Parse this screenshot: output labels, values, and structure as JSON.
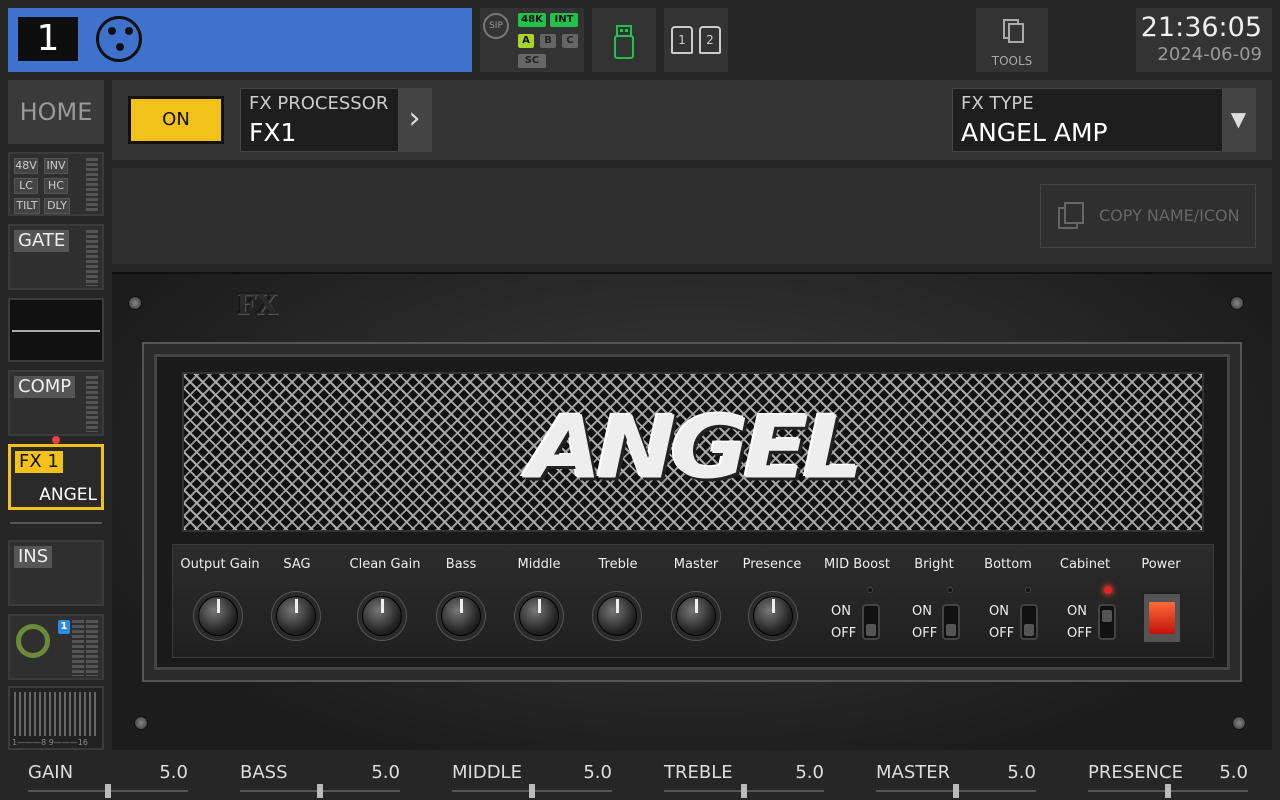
{
  "channel": {
    "number": "1",
    "connector_icon": "xlr-icon"
  },
  "status": {
    "sip": "SIP",
    "rate": "48K",
    "clock": "INT",
    "buses": [
      "A",
      "B",
      "C"
    ],
    "sc": "SC",
    "colors": {
      "active": "#1fc24a",
      "inactive": "#666666"
    }
  },
  "usb": {
    "icon": "usb-icon"
  },
  "cards": {
    "slot1": "1",
    "slot2": "2"
  },
  "tools": {
    "label": "TOOLS",
    "icon": "copy-docs-icon"
  },
  "clock": {
    "time": "21:36:05",
    "date": "2024-06-09"
  },
  "sidebar": {
    "home": "HOME",
    "preamp_tags": [
      "48V",
      "INV",
      "LC",
      "HC",
      "TILT",
      "DLY"
    ],
    "gate": "GATE",
    "comp": "COMP",
    "fx1": {
      "label": "FX 1",
      "name": "ANGEL"
    },
    "ins": "INS",
    "meter_badge": "1",
    "meter_scale": "1———8 9———16"
  },
  "header": {
    "on_label": "ON",
    "fx_processor_label": "FX PROCESSOR",
    "fx_processor_value": "FX1",
    "fx_type_label": "FX TYPE",
    "fx_type_value": "ANGEL AMP"
  },
  "copy_button": "COPY NAME/ICON",
  "amp": {
    "fx_logo": "FX",
    "brand": "ANGEL",
    "knobs": [
      "Output Gain",
      "SAG",
      "Clean Gain",
      "Bass",
      "Middle",
      "Treble",
      "Master",
      "Presence"
    ],
    "switches": [
      {
        "label": "MID Boost",
        "on": "ON",
        "off": "OFF"
      },
      {
        "label": "Bright",
        "on": "ON",
        "off": "OFF"
      },
      {
        "label": "Bottom",
        "on": "ON",
        "off": "OFF"
      },
      {
        "label": "Cabinet",
        "on": "ON",
        "off": "OFF"
      }
    ],
    "power": "Power"
  },
  "params": [
    {
      "name": "GAIN",
      "value": "5.0",
      "level": 0.5
    },
    {
      "name": "BASS",
      "value": "5.0",
      "level": 0.5
    },
    {
      "name": "MIDDLE",
      "value": "5.0",
      "level": 0.5
    },
    {
      "name": "TREBLE",
      "value": "5.0",
      "level": 0.5
    },
    {
      "name": "MASTER",
      "value": "5.0",
      "level": 0.5
    },
    {
      "name": "PRESENCE",
      "value": "5.0",
      "level": 0.5
    }
  ]
}
